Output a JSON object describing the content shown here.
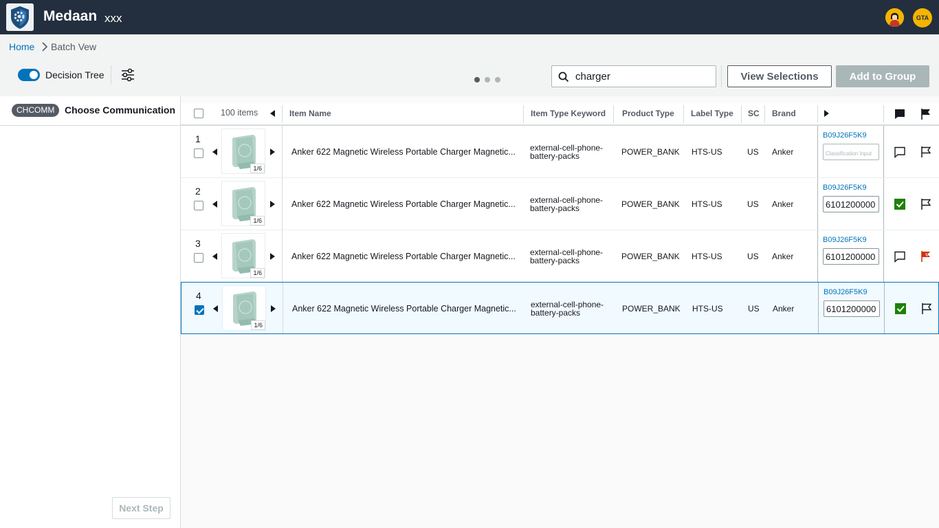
{
  "header": {
    "app_title": "Medaan",
    "app_subtitle": "xxx",
    "user_avatar_icon": "user-avatar-icon",
    "org_badge": "GTA"
  },
  "breadcrumb": {
    "home": "Home",
    "current": "Batch Vew"
  },
  "toolbar": {
    "toggle_label": "Decision Tree",
    "toggle_on": true,
    "page_dots": 3,
    "active_dot": 1,
    "search_value": "charger",
    "view_selections_label": "View Selections",
    "add_to_group_label": "Add to Group"
  },
  "left_panel": {
    "badge": "CHCOMM",
    "title": "Choose Communication",
    "next_step_label": "Next Step"
  },
  "table": {
    "item_count": "100 items",
    "columns": {
      "item_name": "Item Name",
      "item_type_keyword": "Item Type Keyword",
      "product_type": "Product Type",
      "label_type": "Label Type",
      "sc": "SC",
      "brand": "Brand"
    },
    "classification_placeholder": "Classification Input",
    "rows": [
      {
        "num": "1",
        "checked": false,
        "image_count": "1/6",
        "item_name": "Anker 622 Magnetic Wireless Portable Charger Magnetic...",
        "item_type_keyword": "external-cell-phone-battery-packs",
        "product_type": "POWER_BANK",
        "label_type": "HTS-US",
        "sc": "US",
        "brand": "Anker",
        "asin": "B09J26F5K9",
        "classification": "",
        "comment_state": "empty",
        "flag_state": "empty"
      },
      {
        "num": "2",
        "checked": false,
        "image_count": "1/6",
        "item_name": "Anker 622 Magnetic Wireless Portable Charger Magnetic...",
        "item_type_keyword": "external-cell-phone-battery-packs",
        "product_type": "POWER_BANK",
        "label_type": "HTS-US",
        "sc": "US",
        "brand": "Anker",
        "asin": "B09J26F5K9",
        "classification": "6101200000",
        "comment_state": "resolved",
        "flag_state": "empty"
      },
      {
        "num": "3",
        "checked": false,
        "image_count": "1/6",
        "item_name": "Anker 622 Magnetic Wireless Portable Charger Magnetic...",
        "item_type_keyword": "external-cell-phone-battery-packs",
        "product_type": "POWER_BANK",
        "label_type": "HTS-US",
        "sc": "US",
        "brand": "Anker",
        "asin": "B09J26F5K9",
        "classification": "6101200000",
        "comment_state": "empty",
        "flag_state": "flagged"
      },
      {
        "num": "4",
        "checked": true,
        "image_count": "1/6",
        "item_name": "Anker 622 Magnetic Wireless Portable Charger Magnetic...",
        "item_type_keyword": "external-cell-phone-battery-packs",
        "product_type": "POWER_BANK",
        "label_type": "HTS-US",
        "sc": "US",
        "brand": "Anker",
        "asin": "B09J26F5K9",
        "classification": "6101200000",
        "comment_state": "resolved",
        "flag_state": "empty"
      }
    ]
  },
  "colors": {
    "header_bg": "#232f3e",
    "accent": "#0073bb",
    "resolved_green": "#1d8102",
    "flag_red": "#d13212",
    "badge_bg": "#545b64"
  }
}
